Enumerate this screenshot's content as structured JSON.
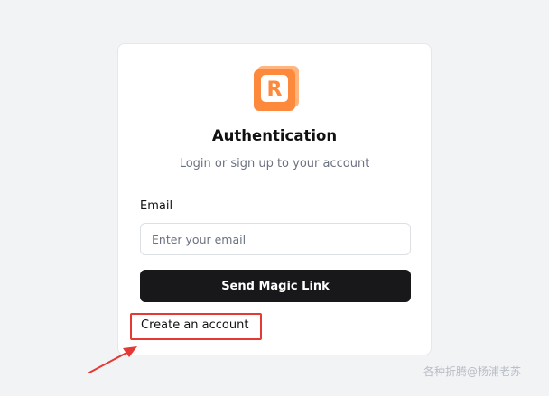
{
  "logo": {
    "letter": "R",
    "colors": {
      "primary": "#fd8a3c",
      "secondary": "#ffb57d",
      "inner": "#ffffff"
    }
  },
  "auth": {
    "title": "Authentication",
    "subtitle": "Login or sign up to your account",
    "email_label": "Email",
    "email_placeholder": "Enter your email",
    "email_value": "",
    "submit_label": "Send Magic Link",
    "create_account_label": "Create an account"
  },
  "annotation": {
    "highlight_color": "#e53935",
    "arrow_color": "#e53935"
  },
  "watermark": "各种折腾@杨浦老苏",
  "colors": {
    "page_bg": "#f2f3f5",
    "card_bg": "#ffffff",
    "button_bg": "#18181b",
    "button_text": "#ffffff",
    "subtitle_text": "#6b7280"
  }
}
